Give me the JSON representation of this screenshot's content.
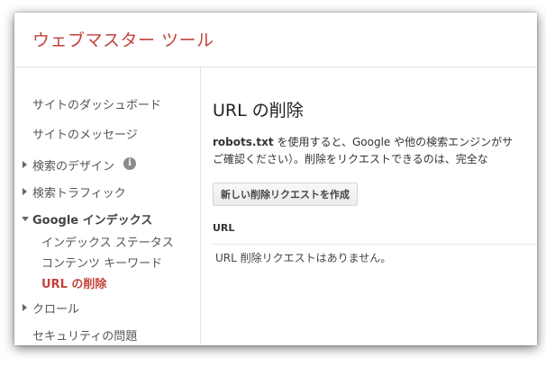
{
  "header": {
    "title": "ウェブマスター ツール"
  },
  "sidebar": {
    "items": [
      {
        "label": "サイトのダッシュボード"
      },
      {
        "label": "サイトのメッセージ"
      },
      {
        "label": "検索のデザイン",
        "info_icon": "i"
      },
      {
        "label": "検索トラフィック"
      },
      {
        "label": "Google インデックス",
        "children": [
          {
            "label": "インデックス ステータス"
          },
          {
            "label": "コンテンツ キーワード"
          },
          {
            "label": "URL の削除"
          }
        ]
      },
      {
        "label": "クロール"
      },
      {
        "label": "セキュリティの問題"
      }
    ]
  },
  "main": {
    "title": "URL の削除",
    "description_bold": "robots.txt",
    "description_line1": " を使用すると、Google や他の検索エンジンがサ",
    "description_line2": "ご確認ください）。削除をリクエストできるのは、完全な",
    "create_button_label": "新しい削除リクエストを作成",
    "table": {
      "column_header": "URL",
      "empty_message": "URL 削除リクエストはありません。"
    }
  },
  "colors": {
    "accent": "#c1433b",
    "border": "#e5e5e5"
  }
}
